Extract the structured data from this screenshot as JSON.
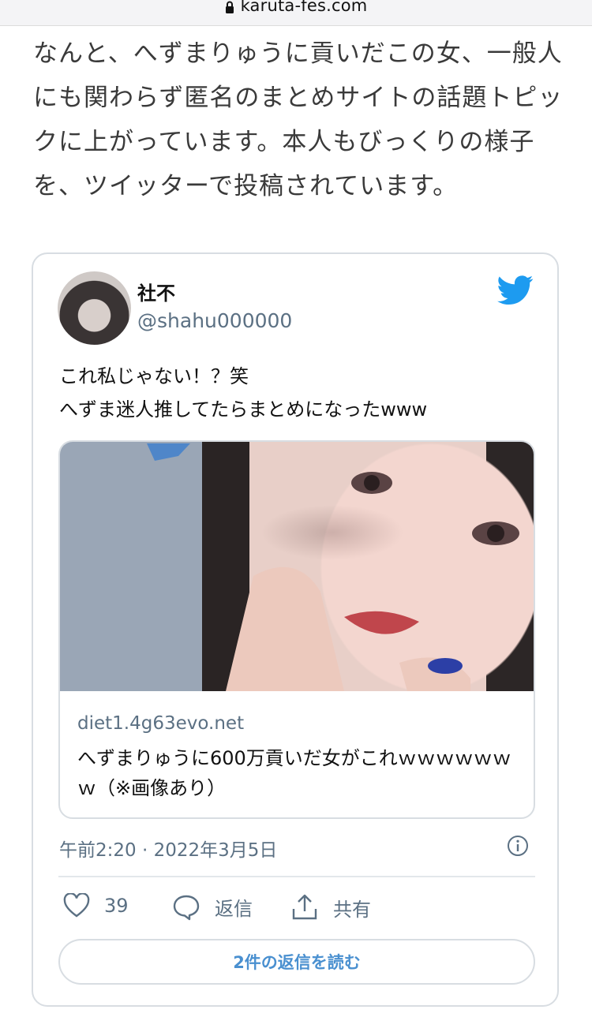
{
  "browser": {
    "url": "karuta-fes.com"
  },
  "article": {
    "paragraph": "なんと、へずまりゅうに貢いだこの女、一般人にも関わらず匿名のまとめサイトの話題トピックに上がっています。本人もびっくりの様子を、ツイッターで投稿されています。"
  },
  "tweet": {
    "display_name": "社不",
    "handle": "@shahu000000",
    "text_line1": "これ私じゃない！？笑",
    "text_line2": "へずま迷人推してたらまとめになったwww",
    "card": {
      "domain": "diet1.4g63evo.net",
      "title": "へずまりゅうに600万貢いだ女がこれｗｗｗｗｗｗｗ（※画像あり）"
    },
    "timestamp": "午前2:20 · 2022年3月5日",
    "likes": "39",
    "reply_label": "返信",
    "share_label": "共有",
    "read_replies": "2件の返信を読む"
  },
  "colors": {
    "twitter_blue": "#1d9bf0",
    "muted": "#5b7083",
    "border": "#d8dde2"
  },
  "icons": [
    "lock-icon",
    "twitter-bird-icon",
    "info-icon",
    "heart-icon",
    "reply-icon",
    "share-icon"
  ]
}
